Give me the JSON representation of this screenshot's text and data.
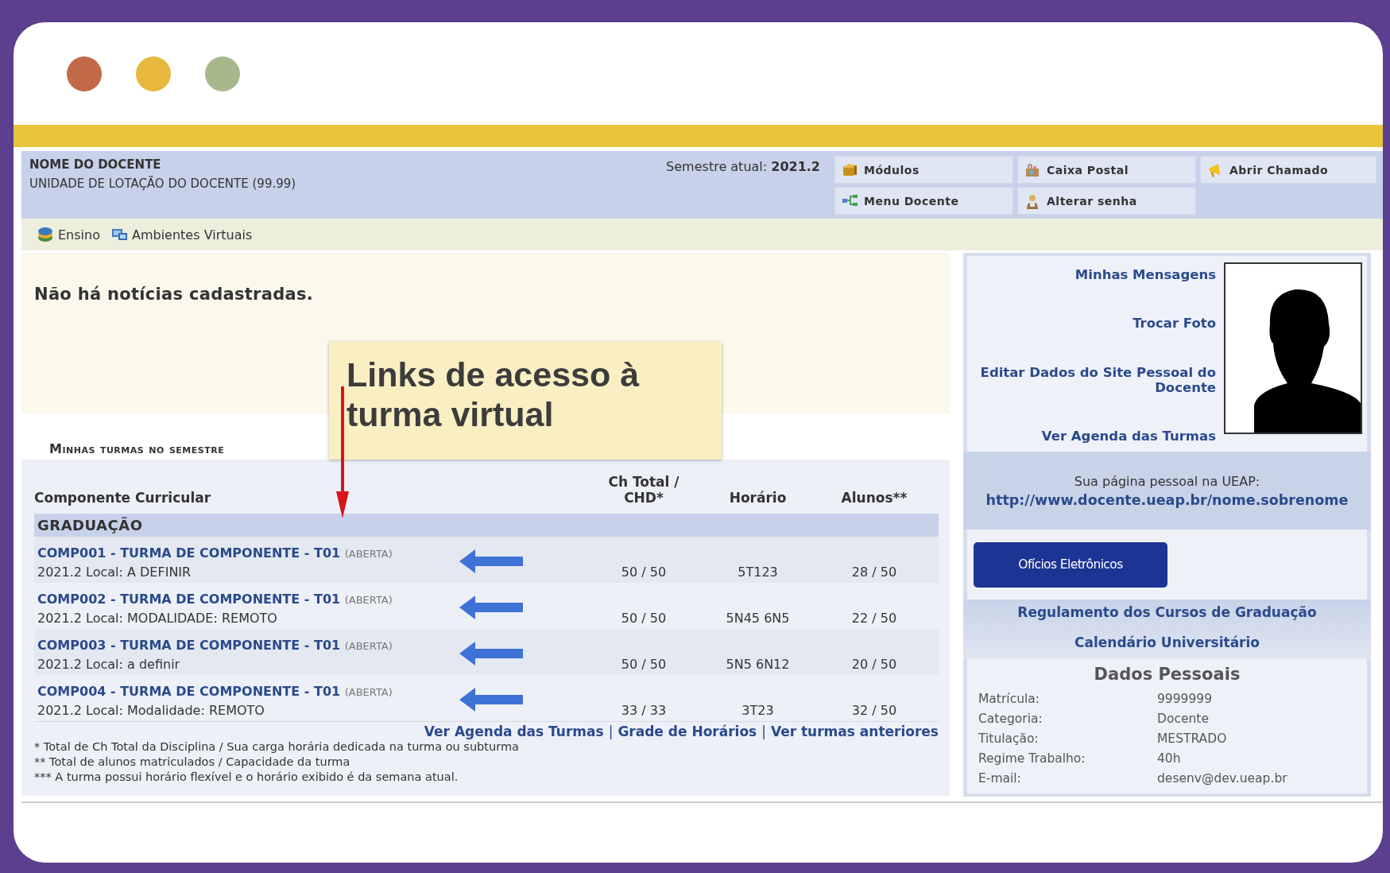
{
  "header": {
    "name": "NOME DO DOCENTE",
    "unit": "UNIDADE DE LOTAÇÃO DO DOCENTE (99.99)",
    "semester_label": "Semestre atual:",
    "semester": "2021.2",
    "buttons": [
      {
        "label": "Módulos"
      },
      {
        "label": "Caixa Postal"
      },
      {
        "label": "Abrir Chamado"
      },
      {
        "label": "Menu Docente"
      },
      {
        "label": "Alterar senha"
      }
    ]
  },
  "menu": [
    {
      "label": "Ensino"
    },
    {
      "label": "Ambientes Virtuais"
    }
  ],
  "news": "Não há notícias cadastradas.",
  "callout": "Links de acesso à turma virtual",
  "classes": {
    "title": "Minhas turmas no semestre",
    "columns": [
      "Componente Curricular",
      "Ch Total / CHD*",
      "Horário",
      "Alunos**"
    ],
    "group": "GRADUAÇÃO",
    "rows": [
      {
        "name": "COMP001 - TURMA DE COMPONENTE - T01",
        "status": "(ABERTA)",
        "detail": "2021.2 Local: A DEFINIR",
        "ch": "50 / 50",
        "schedule": "5T123",
        "students": "28 / 50"
      },
      {
        "name": "COMP002 - TURMA DE COMPONENTE - T01",
        "status": "(ABERTA)",
        "detail": "2021.2 Local: MODALIDADE: REMOTO",
        "ch": "50 / 50",
        "schedule": "5N45 6N5",
        "students": "22 / 50"
      },
      {
        "name": "COMP003 - TURMA DE COMPONENTE - T01",
        "status": "(ABERTA)",
        "detail": "2021.2 Local: a definir",
        "ch": "50 / 50",
        "schedule": "5N5 6N12",
        "students": "20 / 50"
      },
      {
        "name": "COMP004 - TURMA DE COMPONENTE - T01",
        "status": "(ABERTA)",
        "detail": "2021.2 Local: Modalidade: REMOTO",
        "ch": "33 / 33",
        "schedule": "3T23",
        "students": "32 / 50"
      }
    ],
    "links": [
      "Ver Agenda das Turmas",
      "Grade de Horários",
      "Ver turmas anteriores"
    ],
    "link_separator": "|",
    "footnotes": [
      "* Total de Ch Total da Disciplina / Sua carga horária dedicada na turma ou subturma",
      "** Total de alunos matriculados / Capacidade da turma",
      "*** A turma possui horário flexível e o horário exibido é da semana atual."
    ]
  },
  "sidebar": {
    "links": [
      "Minhas Mensagens",
      "Trocar Foto",
      "Editar Dados do Site Pessoal do Docente",
      "Ver Agenda das Turmas"
    ],
    "page_label": "Sua página pessoal na UEAP:",
    "page_url": "http://www.docente.ueap.br/nome.sobrenome",
    "button": "Ofícios Eletrônicos",
    "info_links": [
      "Regulamento dos Cursos de Graduação",
      "Calendário Universitário"
    ],
    "personal": {
      "title": "Dados Pessoais",
      "fields": [
        {
          "label": "Matrícula:",
          "value": "9999999"
        },
        {
          "label": "Categoria:",
          "value": "Docente"
        },
        {
          "label": "Titulação:",
          "value": "MESTRADO"
        },
        {
          "label": "Regime Trabalho:",
          "value": "40h"
        },
        {
          "label": "E-mail:",
          "value": "desenv@dev.ueap.br"
        }
      ]
    }
  }
}
